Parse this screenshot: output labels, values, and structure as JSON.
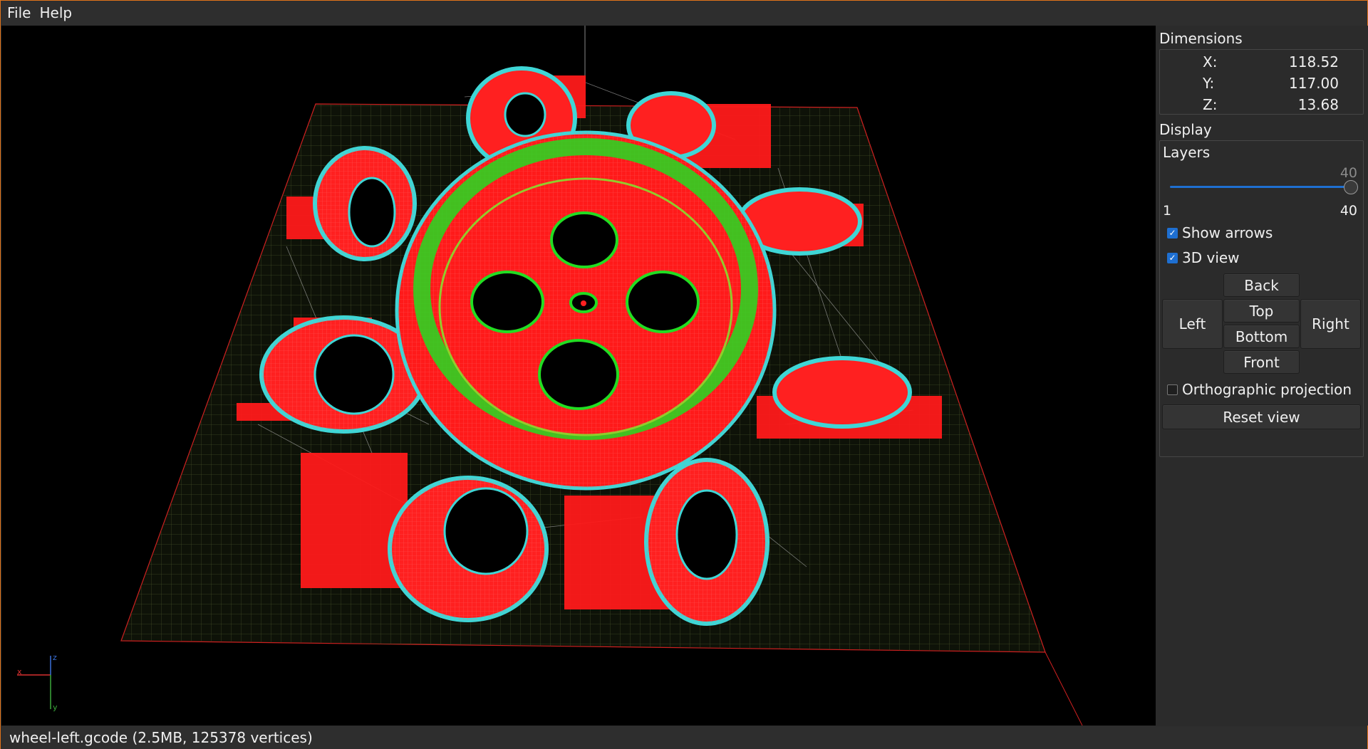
{
  "menubar": {
    "items": [
      "File",
      "Help"
    ]
  },
  "dimensions": {
    "title": "Dimensions",
    "rows": [
      {
        "label": "X:",
        "value": "118.52"
      },
      {
        "label": "Y:",
        "value": "117.00"
      },
      {
        "label": "Z:",
        "value": "13.68"
      }
    ]
  },
  "display": {
    "title": "Display",
    "layers_label": "Layers",
    "slider_current": "40",
    "slider_min": "1",
    "slider_max": "40",
    "slider_fraction": 1.0,
    "show_arrows": {
      "label": "Show arrows",
      "checked": true
    },
    "view_3d": {
      "label": "3D view",
      "checked": true
    },
    "buttons": {
      "back": "Back",
      "top": "Top",
      "bottom": "Bottom",
      "front": "Front",
      "left": "Left",
      "right": "Right"
    },
    "orthographic": {
      "label": "Orthographic projection",
      "checked": false
    },
    "reset": "Reset view"
  },
  "axes": {
    "x": "x",
    "y": "y",
    "z": "z"
  },
  "status": "wheel-left.gcode (2.5MB, 125378 vertices)",
  "colors": {
    "accent": "#e0731a",
    "travel": "#ff0000",
    "perimeter": "#3fd6d6",
    "inner": "#22dd22",
    "moves": "#dddddd",
    "bed_grid": "#4a5a2a"
  }
}
